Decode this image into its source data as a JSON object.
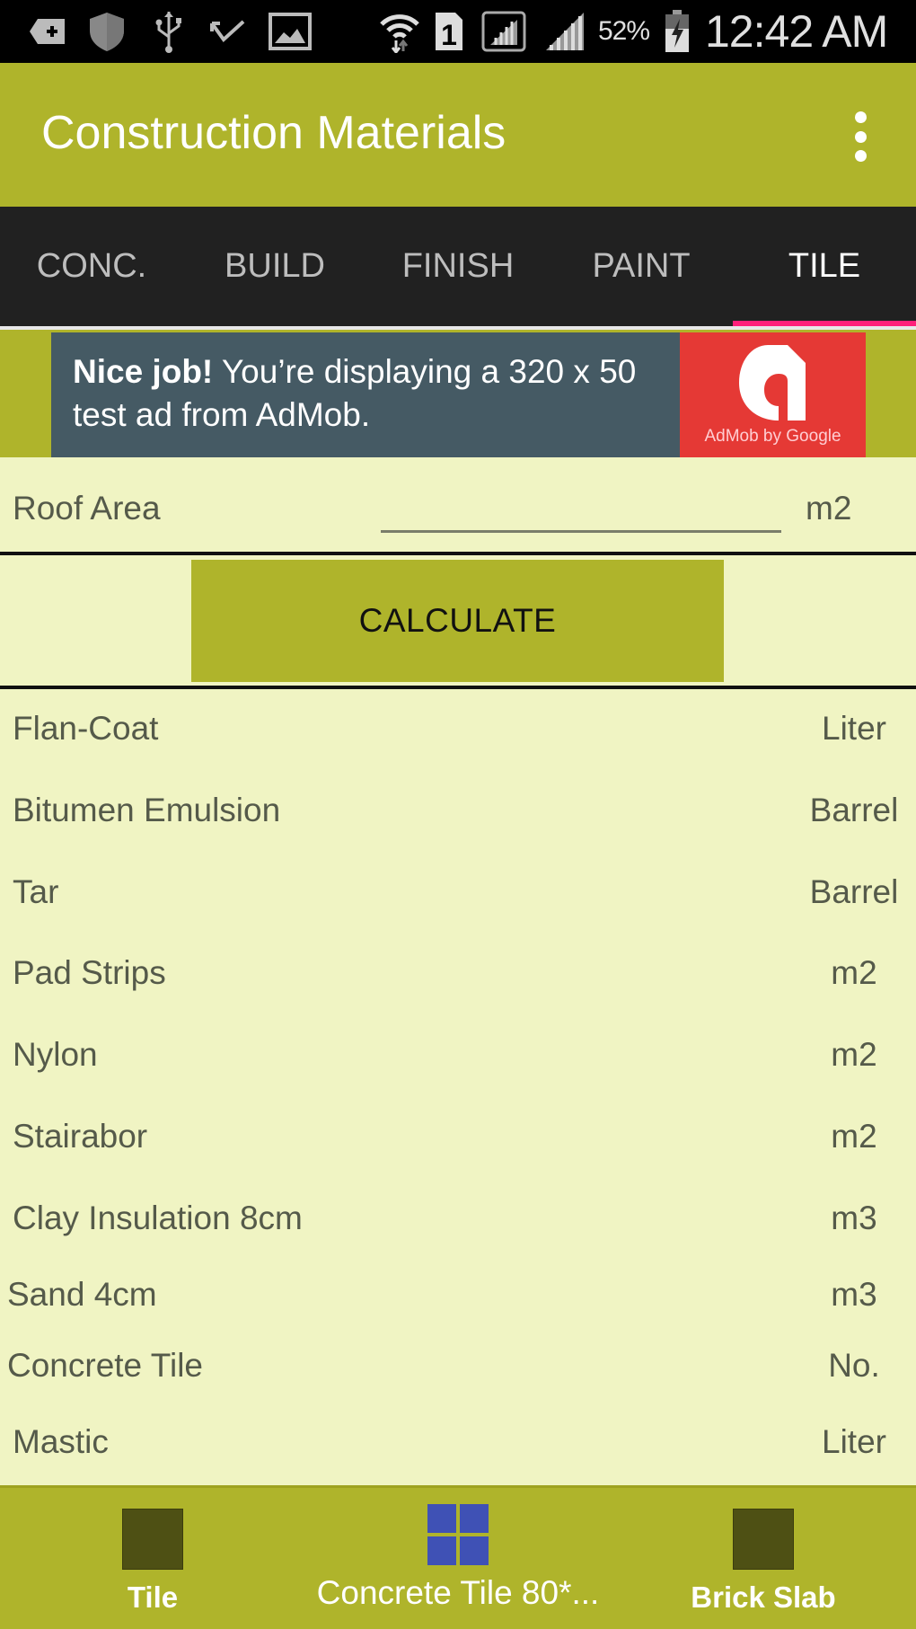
{
  "status_bar": {
    "icons": [
      "add-tag-icon",
      "shield-icon",
      "usb-icon",
      "missed-call-icon",
      "image-icon",
      "wifi-icon",
      "sim-1-icon",
      "signal-box-icon",
      "signal-icon",
      "battery-charging-icon"
    ],
    "battery_percent": "52%",
    "time": "12:42 AM"
  },
  "app_bar": {
    "title": "Construction Materials",
    "overflow_menu": "more-options"
  },
  "tabs": [
    {
      "label": "CONC.",
      "active": false
    },
    {
      "label": "BUILD",
      "active": false
    },
    {
      "label": "FINISH",
      "active": false
    },
    {
      "label": "PAINT",
      "active": false
    },
    {
      "label": "TILE",
      "active": true
    }
  ],
  "ad": {
    "headline": "Nice job!",
    "body": "You’re displaying a 320 x 50 test ad from AdMob.",
    "brand": "AdMob by Google"
  },
  "input": {
    "label": "Roof Area",
    "value": "",
    "unit": "m2"
  },
  "calculate_button": "CALCULATE",
  "materials": [
    {
      "name": "Flan-Coat",
      "unit": "Liter"
    },
    {
      "name": "Bitumen Emulsion",
      "unit": "Barrel"
    },
    {
      "name": "Tar",
      "unit": "Barrel"
    },
    {
      "name": "Pad Strips",
      "unit": "m2"
    },
    {
      "name": "Nylon",
      "unit": "m2"
    },
    {
      "name": "Stairabor",
      "unit": "m2"
    },
    {
      "name": "Clay Insulation 8cm",
      "unit": "m3"
    },
    {
      "name": "Sand 4cm",
      "unit": "m3"
    },
    {
      "name": "Concrete Tile",
      "unit": "No."
    },
    {
      "name": "Mastic",
      "unit": "Liter"
    }
  ],
  "bottom_nav": [
    {
      "label": "Tile",
      "icon": "solid-square-icon",
      "active": false
    },
    {
      "label": "Concrete Tile 80*...",
      "icon": "grid-tiles-icon",
      "active": true
    },
    {
      "label": "Brick Slab",
      "icon": "solid-square-icon",
      "active": false
    }
  ],
  "colors": {
    "primary": "#afb42b",
    "background": "#f0f4c3",
    "tab_bar": "#212121",
    "tab_indicator": "#ff1f7a",
    "ad_background": "#455a64",
    "ad_logo": "#e53935",
    "active_nav_icon": "#3f51b5"
  }
}
